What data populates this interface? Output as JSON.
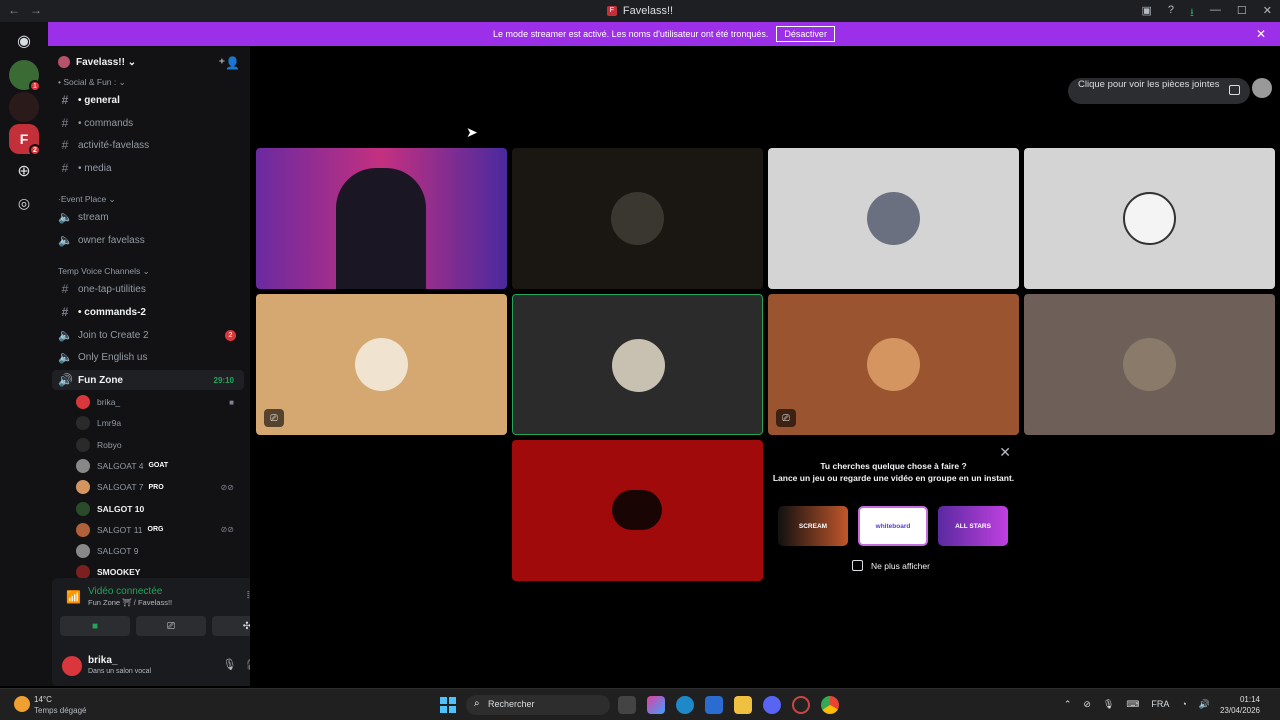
{
  "window": {
    "title": "Favelass!!"
  },
  "banner": {
    "text": "Le mode streamer est activé. Les noms d'utilisateur ont été tronqués.",
    "button": "Désactiver"
  },
  "server": {
    "name": "Favelass!! ⌄"
  },
  "categories": {
    "social": "• Social & Fun : ⌄",
    "event": "·Event Place ⌄",
    "temp": "Temp Voice Channels ⌄"
  },
  "channels": {
    "general": "• general",
    "commands": "• commands",
    "activite": "activité-favelass",
    "media": "• media",
    "stream": "stream",
    "owner": "owner favelass",
    "one_tap": "one-tap-utilities",
    "commands2": "• commands-2",
    "join": "Join to Create 2",
    "join_badge": "2",
    "only_english": "Only English us",
    "fun_zone": "Fun Zone",
    "fun_zone_timer": "29:10"
  },
  "members": [
    {
      "name": "brika_",
      "tag": ""
    },
    {
      "name": "Lmr9a",
      "tag": ""
    },
    {
      "name": "Robyo",
      "tag": ""
    },
    {
      "name": "SALGOAT 4",
      "tag": "GOAT"
    },
    {
      "name": "SALGOAT 7",
      "tag": "PRO"
    },
    {
      "name": "SALGOT 10",
      "tag": ""
    },
    {
      "name": "SALGOT 11",
      "tag": "ORG"
    },
    {
      "name": "SALGOT 9",
      "tag": ""
    },
    {
      "name": "SMOOKEY",
      "tag": ""
    }
  ],
  "voice": {
    "status": "Vidéo connectée",
    "location": "Fun Zone ⛩ / Favelass!!"
  },
  "user": {
    "name": "brika_",
    "status": "Dans un salon vocal"
  },
  "attach_tip": "Clique pour voir les pièces jointes",
  "activity": {
    "line1": "Tu cherches quelque chose à faire ?",
    "line2": "Lance un jeu ou regarde une vidéo en groupe en un instant.",
    "games": [
      "SCREAM",
      "whiteboard",
      "ALL STARS"
    ],
    "no_show": "Ne plus afficher"
  },
  "taskbar": {
    "temp": "14°C",
    "weather": "Temps dégagé",
    "search": "Rechercher",
    "lang": "FRA",
    "time": "01:14",
    "date": "23/04/2026"
  },
  "colors": {
    "banner": "#9b30e8",
    "online": "#23a55a",
    "badge": "#da373c"
  }
}
